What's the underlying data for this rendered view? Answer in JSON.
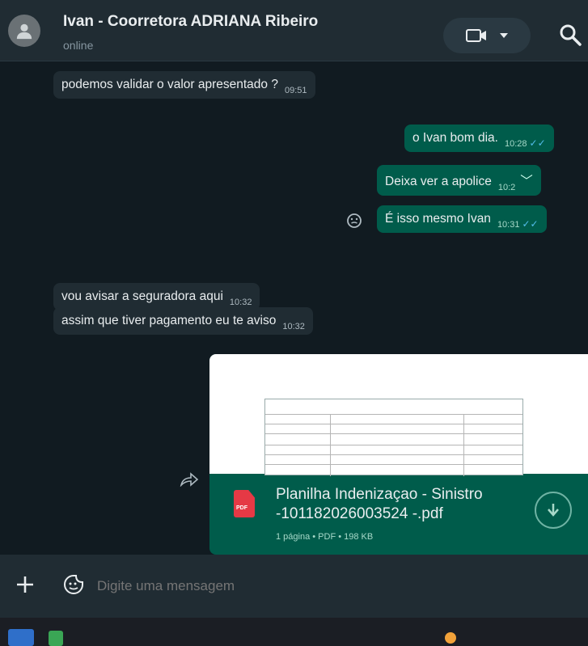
{
  "header": {
    "contact_name": "Ivan - Coorretora ADRIANA Ribeiro",
    "status": "online"
  },
  "messages": [
    {
      "dir": "in",
      "text": "podemos validar o valor apresentado ?",
      "time": "09:51"
    },
    {
      "dir": "out",
      "text": "o Ivan bom dia.",
      "time": "10:28"
    },
    {
      "dir": "out",
      "text": "Deixa ver a apolice",
      "time": "10:2"
    },
    {
      "dir": "out",
      "text": "É isso mesmo Ivan",
      "time": "10:31"
    },
    {
      "dir": "in",
      "text": "vou avisar a seguradora aqui",
      "time": "10:32"
    },
    {
      "dir": "in",
      "text": "assim que tiver pagamento eu te aviso",
      "time": "10:32"
    }
  ],
  "attachment": {
    "icon_label": "PDF",
    "file_name": "Planilha Indenizaçao - Sinistro -101182026003524 -.pdf",
    "meta": "1 página • PDF • 198 KB"
  },
  "composer": {
    "placeholder": "Digite uma mensagem"
  },
  "colors": {
    "incoming": "#202c33",
    "outgoing": "#005c4b",
    "background": "#111b21",
    "read_tick": "#53bdeb",
    "pdf_red": "#e53945"
  },
  "icons": [
    "avatar-icon",
    "video-call-icon",
    "chevron-down-icon",
    "search-icon",
    "emoji-reaction-icon",
    "forward-icon",
    "pdf-icon",
    "download-icon",
    "plus-icon",
    "sticker-icon"
  ]
}
